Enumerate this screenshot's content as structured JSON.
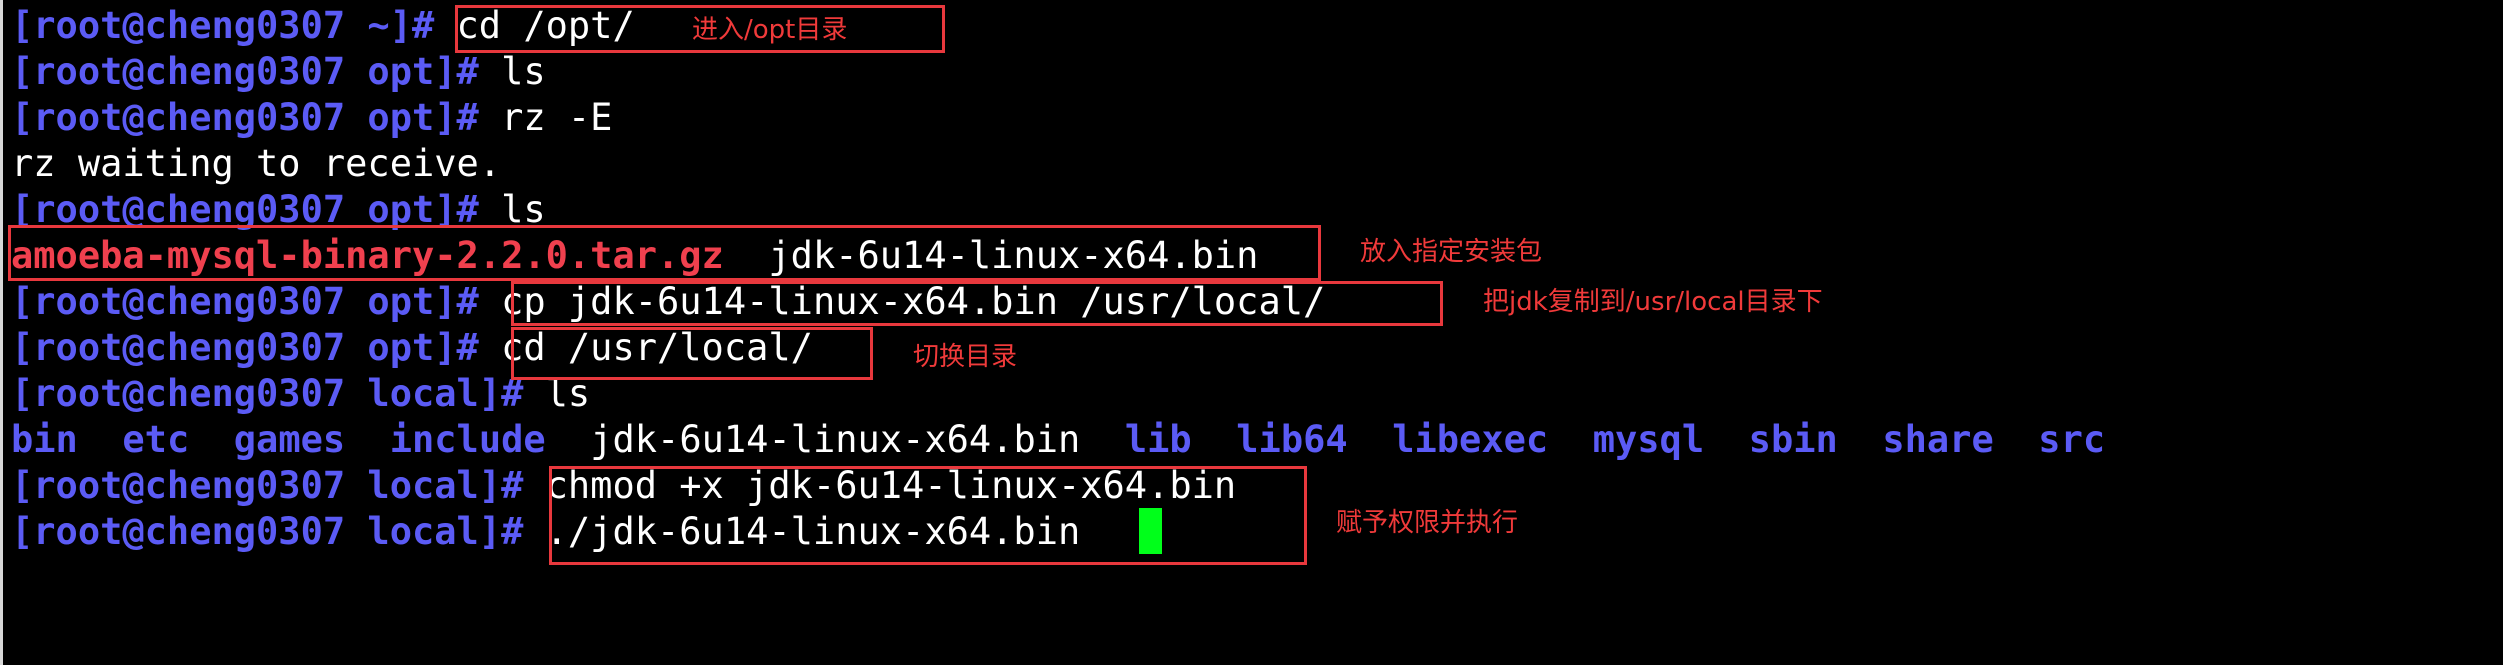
{
  "terminal": {
    "lines": [
      {
        "prompt": "[root@cheng0307 ~]# ",
        "command": "cd /opt/"
      },
      {
        "prompt": "[root@cheng0307 opt]# ",
        "command": "ls"
      },
      {
        "prompt": "[root@cheng0307 opt]# ",
        "command": "rz -E"
      },
      {
        "output": "rz waiting to receive."
      },
      {
        "prompt": "[root@cheng0307 opt]# ",
        "command": "ls"
      },
      {
        "files": [
          "amoeba-mysql-binary-2.2.0.tar.gz",
          "jdk-6u14-linux-x64.bin"
        ]
      },
      {
        "prompt": "[root@cheng0307 opt]# ",
        "command": "cp jdk-6u14-linux-x64.bin /usr/local/"
      },
      {
        "prompt": "[root@cheng0307 opt]# ",
        "command": "cd /usr/local/"
      },
      {
        "prompt": "[root@cheng0307 local]# ",
        "command": "ls"
      },
      {
        "dirs": [
          "bin",
          "etc",
          "games",
          "include",
          "jdk-6u14-linux-x64.bin",
          "lib",
          "lib64",
          "libexec",
          "mysql",
          "sbin",
          "share",
          "src"
        ]
      },
      {
        "prompt": "[root@cheng0307 local]# ",
        "command": "chmod +x jdk-6u14-linux-x64.bin"
      },
      {
        "prompt": "[root@cheng0307 local]# ",
        "command": "./jdk-6u14-linux-x64.bin "
      }
    ],
    "annotations": [
      "进入/opt目录",
      "放入指定安装包",
      "把jdk复制到/usr/local目录下",
      "切换目录",
      "赋予权限并执行"
    ],
    "colors": {
      "prompt": "#5b5bf5",
      "archive": "#f0404e",
      "annotation": "#f03a3a",
      "cursor": "#00ff1a",
      "background": "#000000"
    }
  }
}
